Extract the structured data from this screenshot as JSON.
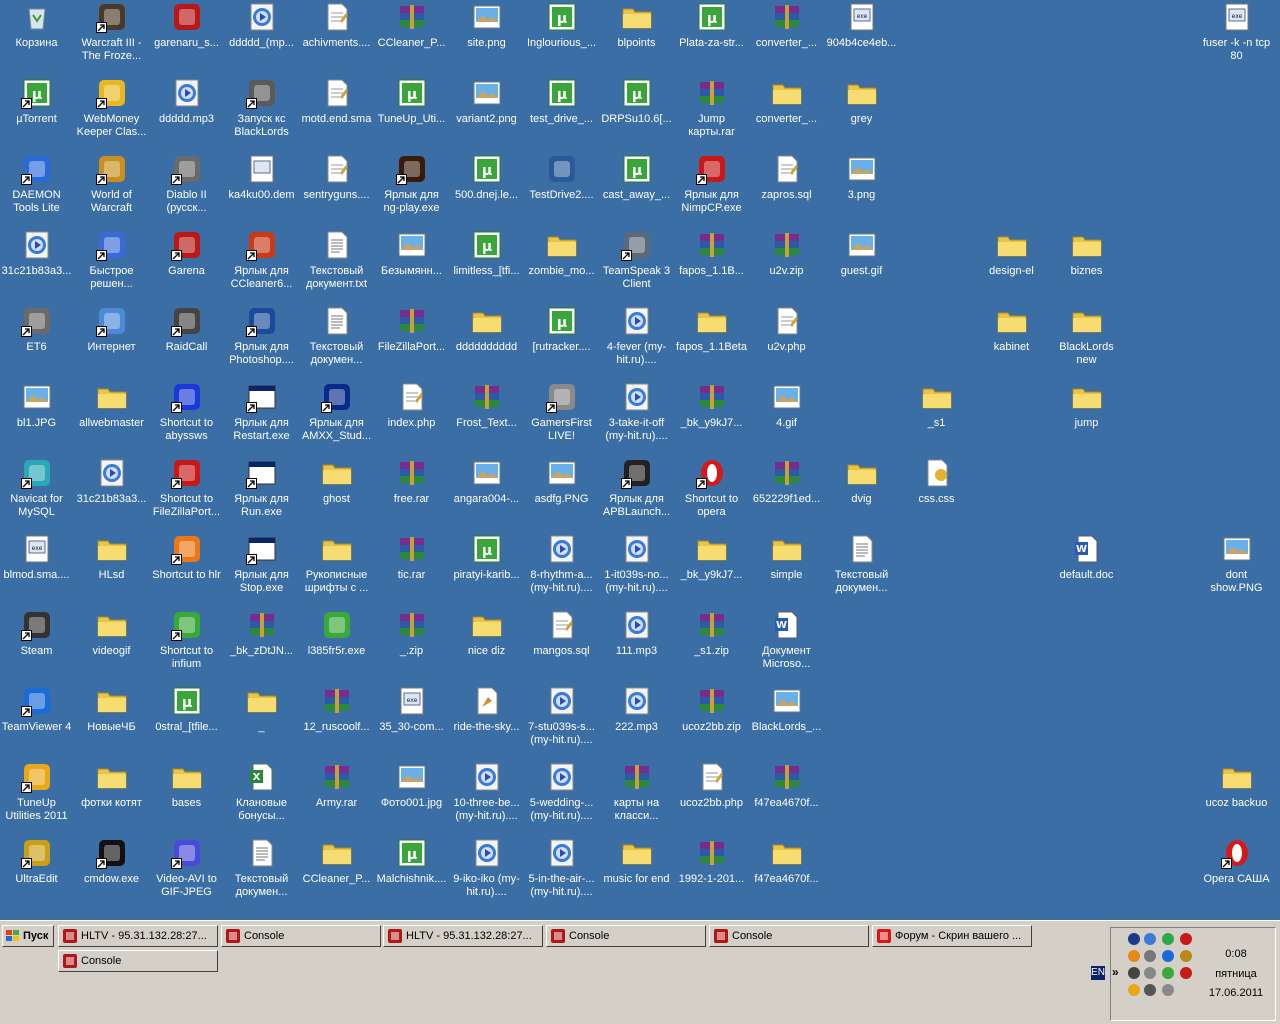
{
  "desktop": {
    "columns": [
      [
        {
          "label": "Корзина",
          "icon": "recycle-bin-icon"
        },
        {
          "label": "µTorrent",
          "icon": "utorrent-icon",
          "shortcut": true
        },
        {
          "label": "DAEMON Tools Lite",
          "icon": "daemon-tools-icon",
          "shortcut": true
        },
        {
          "label": "31c21b83a3...",
          "icon": "media-file-icon"
        },
        {
          "label": "ET6",
          "icon": "steering-wheel-icon",
          "shortcut": true
        },
        {
          "label": "bl1.JPG",
          "icon": "image-file-icon"
        },
        {
          "label": "Navicat for MySQL",
          "icon": "navicat-icon",
          "shortcut": true
        },
        {
          "label": "blmod.sma....",
          "icon": "sma-file-icon"
        },
        {
          "label": "Steam",
          "icon": "steam-icon",
          "shortcut": true
        },
        {
          "label": "TeamViewer 4",
          "icon": "teamviewer-icon",
          "shortcut": true
        },
        {
          "label": "TuneUp Utilities 2011",
          "icon": "tuneup-icon",
          "shortcut": true
        },
        {
          "label": "UltraEdit",
          "icon": "ultraedit-icon",
          "shortcut": true
        }
      ],
      [
        {
          "label": "Warcraft III - The Froze...",
          "icon": "warcraft3-icon",
          "shortcut": true
        },
        {
          "label": "WebMoney Keeper Clas...",
          "icon": "webmoney-icon",
          "shortcut": true
        },
        {
          "label": "World of Warcraft",
          "icon": "wow-icon",
          "shortcut": true
        },
        {
          "label": "Быстрое решен...",
          "icon": "quick-solution-icon",
          "shortcut": true
        },
        {
          "label": "Интернет",
          "icon": "internet-icon",
          "shortcut": true
        },
        {
          "label": "allwebmaster",
          "icon": "folder-icon"
        },
        {
          "label": "31c21b83a3...",
          "icon": "media-file-icon"
        },
        {
          "label": "HLsd",
          "icon": "folder-icon"
        },
        {
          "label": "videogif",
          "icon": "folder-icon"
        },
        {
          "label": "НовыеЧБ",
          "icon": "folder-icon"
        },
        {
          "label": "фотки котят",
          "icon": "folder-icon"
        },
        {
          "label": "cmdow.exe",
          "icon": "cmd-icon",
          "shortcut": true
        }
      ],
      [
        {
          "label": "garenaru_s...",
          "icon": "garena-icon"
        },
        {
          "label": "ddddd.mp3",
          "icon": "media-file-icon"
        },
        {
          "label": "Diablo II (русск...",
          "icon": "diablo-icon",
          "shortcut": true
        },
        {
          "label": "Garena",
          "icon": "garena-icon",
          "shortcut": true
        },
        {
          "label": "RaidCall",
          "icon": "raidcall-icon",
          "shortcut": true
        },
        {
          "label": "Shortcut to abyssws",
          "icon": "abyss-icon",
          "shortcut": true
        },
        {
          "label": "Shortcut to FileZillaPort...",
          "icon": "filezilla-icon",
          "shortcut": true
        },
        {
          "label": "Shortcut to hlr",
          "icon": "halflife-icon",
          "shortcut": true
        },
        {
          "label": "Shortcut to infium",
          "icon": "infium-icon",
          "shortcut": true
        },
        {
          "label": "0stral_[tfile...",
          "icon": "utorrent-icon"
        },
        {
          "label": "bases",
          "icon": "folder-icon"
        },
        {
          "label": "Video-AVI to GIF-JPEG",
          "icon": "video-avi-icon",
          "shortcut": true
        }
      ],
      [
        {
          "label": "ddddd_(mp...",
          "icon": "media-file-icon"
        },
        {
          "label": "Запуск кс BlackLords",
          "icon": "counter-strike-icon",
          "shortcut": true
        },
        {
          "label": "ka4ku00.dem",
          "icon": "dem-file-icon"
        },
        {
          "label": "Ярлык для CCleaner6...",
          "icon": "ccleaner-icon",
          "shortcut": true
        },
        {
          "label": "Ярлык для Photoshop....",
          "icon": "photoshop-icon",
          "shortcut": true
        },
        {
          "label": "Ярлык для Restart.exe",
          "icon": "window-exe-icon",
          "shortcut": true
        },
        {
          "label": "Ярлык для Run.exe",
          "icon": "window-exe-icon",
          "shortcut": true
        },
        {
          "label": "Ярлык для Stop.exe",
          "icon": "window-exe-icon",
          "shortcut": true
        },
        {
          "label": "_bk_zDtJN...",
          "icon": "rar-icon"
        },
        {
          "label": "_",
          "icon": "folder-icon"
        },
        {
          "label": "Клановые бонусы...",
          "icon": "excel-icon"
        },
        {
          "label": "Текстовый докумен...",
          "icon": "text-file-icon"
        }
      ],
      [
        {
          "label": "achivments....",
          "icon": "php-file-icon"
        },
        {
          "label": "motd.end.sma",
          "icon": "php-file-icon"
        },
        {
          "label": "sentryguns....",
          "icon": "php-file-icon"
        },
        {
          "label": "Текстовый документ.txt",
          "icon": "text-file-icon"
        },
        {
          "label": "Текстовый докумен...",
          "icon": "text-file-icon"
        },
        {
          "label": "Ярлык для AMXX_Stud...",
          "icon": "amxx-icon",
          "shortcut": true
        },
        {
          "label": "ghost",
          "icon": "folder-icon"
        },
        {
          "label": "Рукописные шрифты с ...",
          "icon": "folder-icon"
        },
        {
          "label": "l385fr5r.exe",
          "icon": "drweb-icon"
        },
        {
          "label": "12_ruscoolf...",
          "icon": "rar-icon"
        },
        {
          "label": "Army.rar",
          "icon": "rar-icon"
        },
        {
          "label": "CCleaner_P...",
          "icon": "folder-icon"
        }
      ],
      [
        {
          "label": "CCleaner_P...",
          "icon": "rar-icon"
        },
        {
          "label": "TuneUp_Uti...",
          "icon": "utorrent-icon"
        },
        {
          "label": "Ярлык для ng-play.exe",
          "icon": "ng-play-icon",
          "shortcut": true
        },
        {
          "label": "Безымянн...",
          "icon": "image-file-icon"
        },
        {
          "label": "FileZillaPort...",
          "icon": "rar-icon"
        },
        {
          "label": "index.php",
          "icon": "php-file-icon"
        },
        {
          "label": "free.rar",
          "icon": "rar-icon"
        },
        {
          "label": "tic.rar",
          "icon": "rar-icon"
        },
        {
          "label": "_.zip",
          "icon": "rar-icon"
        },
        {
          "label": "35_30-com...",
          "icon": "sma-file-icon"
        },
        {
          "label": "Фото001.jpg",
          "icon": "image-file-icon"
        },
        {
          "label": "Malchishnik....",
          "icon": "utorrent-icon"
        }
      ],
      [
        {
          "label": "site.png",
          "icon": "image-file-icon"
        },
        {
          "label": "variant2.png",
          "icon": "image-file-icon"
        },
        {
          "label": "500.dnej.le...",
          "icon": "utorrent-icon"
        },
        {
          "label": "limitless_[tfi...",
          "icon": "utorrent-icon"
        },
        {
          "label": "dddddddddd",
          "icon": "folder-icon"
        },
        {
          "label": "Frost_Text...",
          "icon": "rar-icon"
        },
        {
          "label": "angara004-...",
          "icon": "image-file-icon"
        },
        {
          "label": "piratyi-karib...",
          "icon": "utorrent-icon"
        },
        {
          "label": "nice diz",
          "icon": "folder-icon"
        },
        {
          "label": "ride-the-sky...",
          "icon": "sky-file-icon"
        },
        {
          "label": "10-three-be... (my-hit.ru)....",
          "icon": "media-file-icon"
        },
        {
          "label": "9-iko-iko (my-hit.ru)....",
          "icon": "media-file-icon"
        }
      ],
      [
        {
          "label": "Inglourious_...",
          "icon": "utorrent-icon"
        },
        {
          "label": "test_drive_...",
          "icon": "utorrent-icon"
        },
        {
          "label": "TestDrive2....",
          "icon": "testdrive-icon"
        },
        {
          "label": "zombie_mo...",
          "icon": "folder-icon"
        },
        {
          "label": "[rutracker....",
          "icon": "utorrent-icon"
        },
        {
          "label": "GamersFirst LIVE!",
          "icon": "gamersfirst-icon",
          "shortcut": true
        },
        {
          "label": "asdfg.PNG",
          "icon": "image-file-icon"
        },
        {
          "label": "8-rhythm-a... (my-hit.ru)....",
          "icon": "media-file-icon"
        },
        {
          "label": "mangos.sql",
          "icon": "php-file-icon"
        },
        {
          "label": "7-stu039s-s... (my-hit.ru)....",
          "icon": "media-file-icon"
        },
        {
          "label": "5-wedding-... (my-hit.ru)....",
          "icon": "media-file-icon"
        },
        {
          "label": "5-in-the-air-... (my-hit.ru)....",
          "icon": "media-file-icon"
        }
      ],
      [
        {
          "label": "blpoints",
          "icon": "folder-icon"
        },
        {
          "label": "DRPSu10.6[...",
          "icon": "utorrent-icon"
        },
        {
          "label": "cast_away_...",
          "icon": "utorrent-icon"
        },
        {
          "label": "TeamSpeak 3 Client",
          "icon": "teamspeak-icon",
          "shortcut": true
        },
        {
          "label": "4-fever (my-hit.ru)....",
          "icon": "media-file-icon"
        },
        {
          "label": "3-take-it-off (my-hit.ru)....",
          "icon": "media-file-icon"
        },
        {
          "label": "Ярлык для APBLaunch...",
          "icon": "apb-icon",
          "shortcut": true
        },
        {
          "label": "1-it039s-no... (my-hit.ru)....",
          "icon": "media-file-icon"
        },
        {
          "label": "111.mp3",
          "icon": "media-file-icon"
        },
        {
          "label": "222.mp3",
          "icon": "media-file-icon"
        },
        {
          "label": "карты на класси...",
          "icon": "rar-icon"
        },
        {
          "label": "music for end",
          "icon": "folder-icon"
        }
      ],
      [
        {
          "label": "Plata-za-str...",
          "icon": "utorrent-icon"
        },
        {
          "label": "Jump карты.rar",
          "icon": "rar-icon"
        },
        {
          "label": "Ярлык для NimpCP.exe",
          "icon": "nimpcp-icon",
          "shortcut": true
        },
        {
          "label": "fapos_1.1B...",
          "icon": "rar-icon"
        },
        {
          "label": "fapos_1.1Beta",
          "icon": "folder-icon"
        },
        {
          "label": "_bk_y9kJ7...",
          "icon": "rar-icon"
        },
        {
          "label": "Shortcut to opera",
          "icon": "opera-icon",
          "shortcut": true
        },
        {
          "label": "_bk_y9kJ7...",
          "icon": "folder-icon"
        },
        {
          "label": "_s1.zip",
          "icon": "rar-icon"
        },
        {
          "label": "ucoz2bb.zip",
          "icon": "rar-icon"
        },
        {
          "label": "ucoz2bb.php",
          "icon": "php-file-icon"
        },
        {
          "label": "1992-1-201...",
          "icon": "rar-icon"
        }
      ],
      [
        {
          "label": "converter_...",
          "icon": "rar-icon"
        },
        {
          "label": "converter_...",
          "icon": "folder-icon"
        },
        {
          "label": "zapros.sql",
          "icon": "php-file-icon"
        },
        {
          "label": "u2v.zip",
          "icon": "rar-icon"
        },
        {
          "label": "u2v.php",
          "icon": "php-file-icon"
        },
        {
          "label": "4.gif",
          "icon": "image-file-icon"
        },
        {
          "label": "652229f1ed...",
          "icon": "rar-icon"
        },
        {
          "label": "simple",
          "icon": "folder-icon"
        },
        {
          "label": "Документ Microso...",
          "icon": "word-icon"
        },
        {
          "label": "BlackLords_...",
          "icon": "image-file-icon"
        },
        {
          "label": "f47ea4670f...",
          "icon": "rar-icon"
        },
        {
          "label": "f47ea4670f...",
          "icon": "folder-icon"
        }
      ],
      [
        {
          "label": "904b4ce4eb...",
          "icon": "sma-file-icon"
        },
        {
          "label": "grey",
          "icon": "folder-icon"
        },
        {
          "label": "3.png",
          "icon": "image-file-icon"
        },
        {
          "label": "guest.gif",
          "icon": "image-file-icon"
        },
        null,
        null,
        {
          "label": "dvig",
          "icon": "folder-icon"
        },
        {
          "label": "Текстовый докумен...",
          "icon": "text-file-icon"
        },
        null,
        null,
        null,
        null
      ]
    ],
    "extra": [
      {
        "col": 12,
        "row": 5,
        "label": "_s1",
        "icon": "folder-icon"
      },
      {
        "col": 12,
        "row": 6,
        "label": "css.css",
        "icon": "css-file-icon"
      },
      {
        "col": 13,
        "row": 3,
        "label": "design-el",
        "icon": "folder-icon"
      },
      {
        "col": 13,
        "row": 4,
        "label": "kabinet",
        "icon": "folder-icon"
      },
      {
        "col": 14,
        "row": 3,
        "label": "biznes",
        "icon": "folder-icon"
      },
      {
        "col": 14,
        "row": 4,
        "label": "BlackLords new",
        "icon": "folder-icon"
      },
      {
        "col": 14,
        "row": 5,
        "label": "jump",
        "icon": "folder-icon"
      },
      {
        "col": 14,
        "row": 7,
        "label": "default.doc",
        "icon": "word-icon"
      },
      {
        "col": 16,
        "row": 0,
        "label": "fuser -k -n tcp 80",
        "icon": "sma-file-icon"
      },
      {
        "col": 16,
        "row": 7,
        "label": "dont show.PNG",
        "icon": "image-file-icon"
      },
      {
        "col": 16,
        "row": 10,
        "label": "ucoz backuo",
        "icon": "folder-icon"
      },
      {
        "col": 16,
        "row": 11,
        "label": "Opera САША",
        "icon": "opera-icon",
        "shortcut": true
      }
    ]
  },
  "taskbar": {
    "start_label": "Пуск",
    "buttons": [
      {
        "label": "HLTV - 95.31.132.28:27...",
        "icon": "hltv-icon"
      },
      {
        "label": "Console",
        "icon": "console-icon"
      },
      {
        "label": "HLTV - 95.31.132.28:27...",
        "icon": "hltv-icon"
      },
      {
        "label": "Console",
        "icon": "console-icon"
      },
      {
        "label": "Console",
        "icon": "console-icon"
      },
      {
        "label": "Форум - Скрин вашего ...",
        "icon": "opera-icon"
      },
      {
        "label": "Console",
        "icon": "console-icon"
      }
    ],
    "lang": "EN",
    "chevron": "»",
    "clock": {
      "time": "0:08",
      "day": "пятница",
      "date": "17.06.2011"
    }
  },
  "colors": {
    "desktop": "#3a6ea5",
    "taskbar": "#d4d0c8"
  }
}
